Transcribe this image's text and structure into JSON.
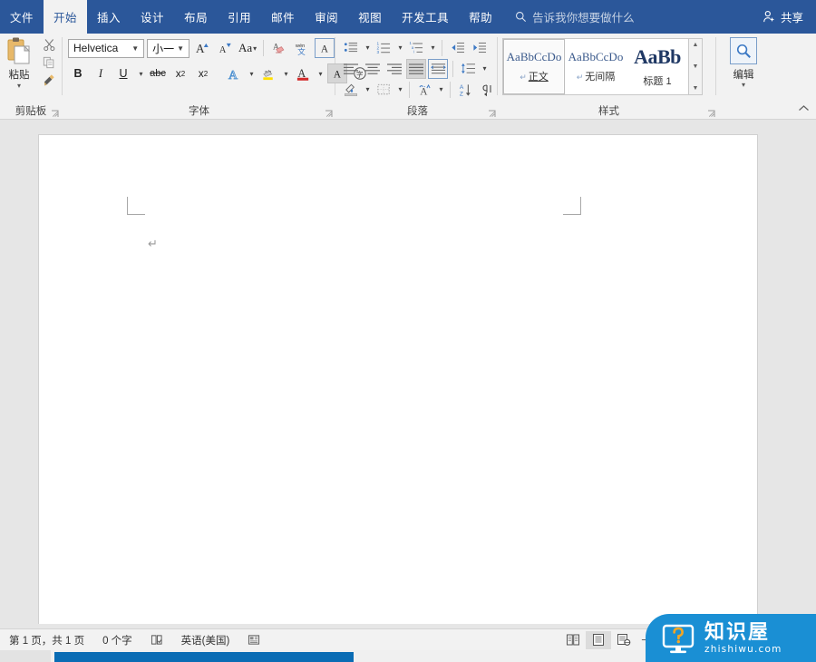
{
  "window": {
    "app": "Microsoft Word",
    "accent_color": "#2b579a",
    "ribbon_bg": "#f2f2f2"
  },
  "tabs": [
    {
      "label": "文件",
      "active": false
    },
    {
      "label": "开始",
      "active": true
    },
    {
      "label": "插入",
      "active": false
    },
    {
      "label": "设计",
      "active": false
    },
    {
      "label": "布局",
      "active": false
    },
    {
      "label": "引用",
      "active": false
    },
    {
      "label": "邮件",
      "active": false
    },
    {
      "label": "审阅",
      "active": false
    },
    {
      "label": "视图",
      "active": false
    },
    {
      "label": "开发工具",
      "active": false
    },
    {
      "label": "帮助",
      "active": false
    }
  ],
  "tellme": {
    "icon": "search-icon",
    "placeholder": "告诉我你想要做什么"
  },
  "share": {
    "icon": "person-add-icon",
    "label": "共享"
  },
  "groups": {
    "clipboard": {
      "label": "剪贴板",
      "paste_label": "粘贴",
      "paste_icon": "clipboard-icon",
      "cut_icon": "scissors-icon",
      "copy_icon": "copy-icon",
      "format_painter_icon": "format-painter-icon",
      "dialog_launcher": "dialog-launcher-icon"
    },
    "font": {
      "label": "字体",
      "font_name": "Helvetica",
      "font_size": "小一",
      "grow_font_icon": "grow-font-icon",
      "shrink_font_icon": "shrink-font-icon",
      "change_case_label": "Aa",
      "clear_formatting_icon": "clear-formatting-icon",
      "phonetic_icon": "phonetic-guide-icon",
      "char_border_icon": "character-border-icon",
      "bold_label": "B",
      "italic_label": "I",
      "underline_label": "U",
      "strikethrough_label": "abc",
      "subscript_label": "x",
      "superscript_label": "x",
      "text_effects_icon": "text-effects-icon",
      "highlight_icon": "text-highlight-icon",
      "font_color_icon": "font-color-icon",
      "char_shading_icon": "character-shading-icon",
      "enclose_char_icon": "enclose-character-icon",
      "dialog_launcher": "dialog-launcher-icon"
    },
    "paragraph": {
      "label": "段落",
      "bullets_icon": "bullet-list-icon",
      "numbering_icon": "numbered-list-icon",
      "multilevel_icon": "multilevel-list-icon",
      "decrease_indent_icon": "decrease-indent-icon",
      "increase_indent_icon": "increase-indent-icon",
      "align_left_icon": "align-left-icon",
      "align_center_icon": "align-center-icon",
      "align_right_icon": "align-right-icon",
      "justify_icon": "justify-icon",
      "distributed_icon": "distributed-align-icon",
      "line_spacing_icon": "line-spacing-icon",
      "shading_icon": "shading-icon",
      "borders_icon": "borders-icon",
      "asian_layout_icon": "asian-layout-icon",
      "sort_icon": "sort-icon",
      "show_marks_icon": "show-paragraph-marks-icon",
      "active_alignment": "justify",
      "dialog_launcher": "dialog-launcher-icon"
    },
    "styles": {
      "label": "样式",
      "items": [
        {
          "sample": "AaBbCcDo",
          "name": "正文",
          "selected": true,
          "big": false,
          "underline": true
        },
        {
          "sample": "AaBbCcDo",
          "name": "无间隔",
          "selected": false,
          "big": false,
          "underline": false
        },
        {
          "sample": "AaBb",
          "name": "标题 1",
          "selected": false,
          "big": true,
          "underline": false
        }
      ],
      "scroll_up_icon": "scroll-up-icon",
      "scroll_down_icon": "scroll-down-icon",
      "more_styles_icon": "more-styles-icon",
      "dialog_launcher": "dialog-launcher-icon"
    },
    "editing": {
      "label": "编辑",
      "icon": "search-icon"
    },
    "collapse_ribbon_icon": "collapse-ribbon-icon"
  },
  "document": {
    "paragraph_mark": "↵",
    "margin_marks": 2,
    "page_background": "#ffffff"
  },
  "statusbar": {
    "page_info": "第 1 页，共 1 页",
    "word_count": "0 个字",
    "proofing_icon": "proofing-errors-icon",
    "language": "英语(美国)",
    "accessibility_icon": "accessibility-icon",
    "view_read_icon": "read-mode-icon",
    "view_print_icon": "print-layout-icon",
    "view_web_icon": "web-layout-icon",
    "zoom_out_label": "−",
    "active_view": "print-layout"
  },
  "watermark": {
    "cn": "知识屋",
    "en": "zhishiwu.com",
    "icon": "monitor-question-icon",
    "color": "#1a8fd4"
  }
}
